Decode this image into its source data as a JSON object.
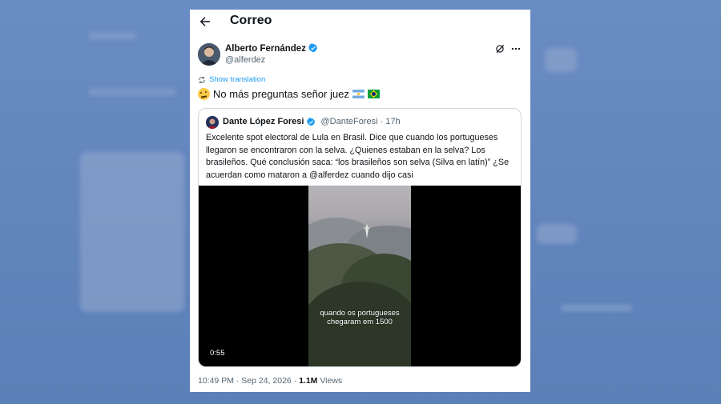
{
  "header": {
    "title": "Correo"
  },
  "tweet": {
    "author_name": "Alberto Fernández",
    "author_handle": "@alferdez",
    "translate_label": "Show translation",
    "text": "No más preguntas señor juez",
    "timestamp": "10:49 PM · Sep 24, 2026 · ",
    "views_count": "1.1M",
    "views_label": " Views"
  },
  "quote": {
    "author_name": "Dante López Foresi",
    "author_handle": "@DanteForesi",
    "time": "· 17h",
    "text": "Excelente spot electoral de Lula en Brasil. Dice que cuando los portugueses llegaron se encontraron con la selva. ¿Quienes estaban en la selva? Los brasileños. Qué conclusión saca: “los brasileños son selva (Silva en latín)” ¿Se acuerdan como mataron  a @alferdez cuando dijo casi",
    "video": {
      "caption_line1": "quando os portugueses",
      "caption_line2": "chegaram em 1500",
      "duration": "0:55"
    }
  },
  "colors": {
    "accent": "#1d9bf0",
    "verified": "#1d9bf0",
    "background": "#5f84bc"
  },
  "icons": [
    "back-arrow-icon",
    "verified-icon",
    "grok-icon",
    "more-icon",
    "translate-icon",
    "thinking-face-emoji",
    "argentina-flag",
    "brazil-flag"
  ]
}
